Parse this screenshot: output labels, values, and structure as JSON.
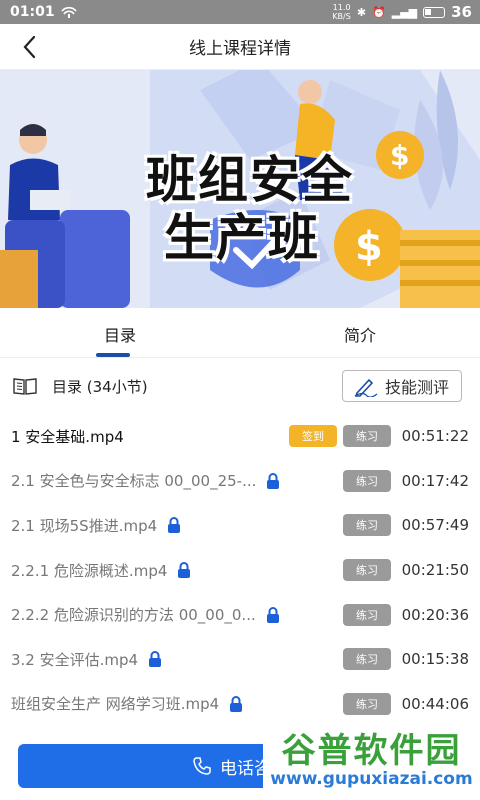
{
  "status_bar": {
    "time": "01:01",
    "net_speed_top": "11.0",
    "net_speed_bottom": "KB/S",
    "battery_pct": "36"
  },
  "nav": {
    "title": "线上课程详情"
  },
  "banner": {
    "title_line1": "班组安全",
    "title_line2": "生产班"
  },
  "tabs": [
    {
      "label": "目录",
      "active": true
    },
    {
      "label": "简介",
      "active": false
    }
  ],
  "catalog": {
    "label": "目录 (34小节)",
    "skill_button": "技能测评"
  },
  "lessons": [
    {
      "name": "1 安全基础.mp4",
      "current": true,
      "locked": false,
      "sign_label": "签到",
      "practice_label": "练习",
      "duration": "00:51:22"
    },
    {
      "name": "2.1 安全色与安全标志 00_00_25-...",
      "current": false,
      "locked": true,
      "practice_label": "练习",
      "duration": "00:17:42"
    },
    {
      "name": "2.1 现场5S推进.mp4",
      "current": false,
      "locked": true,
      "practice_label": "练习",
      "duration": "00:57:49"
    },
    {
      "name": "2.2.1 危险源概述.mp4",
      "current": false,
      "locked": true,
      "practice_label": "练习",
      "duration": "00:21:50"
    },
    {
      "name": "2.2.2 危险源识别的方法 00_00_0...",
      "current": false,
      "locked": true,
      "practice_label": "练习",
      "duration": "00:20:36"
    },
    {
      "name": "3.2 安全评估.mp4",
      "current": false,
      "locked": true,
      "practice_label": "练习",
      "duration": "00:15:38"
    },
    {
      "name": "班组安全生产 网络学习班.mp4",
      "current": false,
      "locked": true,
      "practice_label": "练习",
      "duration": "00:44:06"
    }
  ],
  "bottom": {
    "call_button": "电话咨询"
  },
  "watermark": {
    "name": "谷普软件园",
    "url": "www.gupuxiazai.com"
  },
  "colors": {
    "accent": "#1f6ee8",
    "tab_indicator": "#1b4ea8",
    "sign_badge": "#f4b427",
    "practice_badge": "#9a9a9a",
    "lock": "#1d5fd6"
  }
}
